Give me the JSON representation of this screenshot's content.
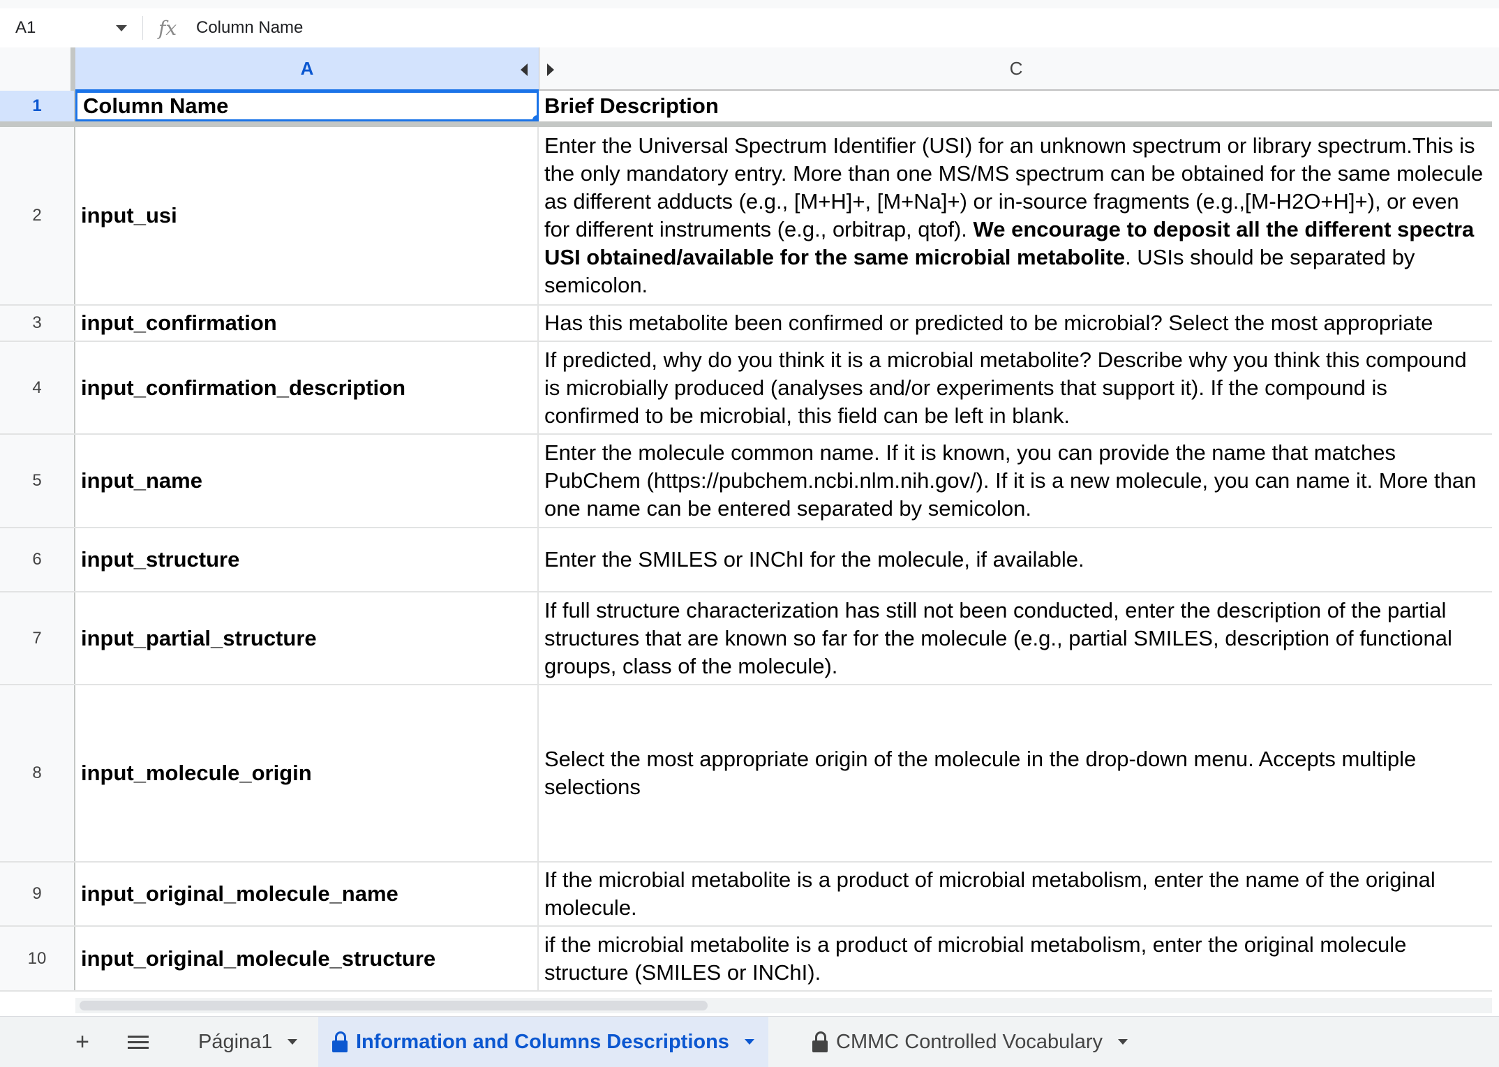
{
  "formula_bar": {
    "cell_ref": "A1",
    "fx_icon": "fx",
    "content": "Column Name"
  },
  "columns": [
    {
      "label": "A"
    },
    {
      "label": "C"
    }
  ],
  "rows": [
    {
      "num": "1",
      "name": "Column Name",
      "desc": "Brief Description"
    },
    {
      "num": "2",
      "name": "input_usi",
      "desc": "Enter the Universal Spectrum Identifier (USI) for an unknown spectrum or library spectrum.This is the only mandatory entry. More than one MS/MS spectrum can be obtained for the same molecule as different adducts (e.g., [M+H]+, [M+Na]+) or in-source fragments (e.g.,[M-H2O+H]+), or even for different instruments (e.g., orbitrap, qtof). ",
      "desc_bold": "We encourage to deposit all the different spectra USI obtained/available for the same microbial metabolite",
      "desc_tail": ". USIs should be separated by semicolon."
    },
    {
      "num": "3",
      "name": "input_confirmation",
      "desc": "Has this metabolite been confirmed or predicted to be microbial? Select the most appropriate"
    },
    {
      "num": "4",
      "name": "input_confirmation_description",
      "desc": "If predicted, why do you think it is a microbial metabolite? Describe why you think this compound is microbially produced (analyses and/or experiments that support it). If the compound is confirmed to be microbial, this field can be left in blank."
    },
    {
      "num": "5",
      "name": "input_name",
      "desc": "Enter the molecule common name. If it is known, you can provide the name that matches PubChem (https://pubchem.ncbi.nlm.nih.gov/). If it is a new molecule, you can name it. More than one name can be entered separated by semicolon."
    },
    {
      "num": "6",
      "name": "input_structure",
      "desc": "Enter the SMILES or INChI for the molecule, if available."
    },
    {
      "num": "7",
      "name": "input_partial_structure",
      "desc": "If full structure characterization has still not been conducted, enter the description of the partial structures that are known so far for the molecule (e.g., partial SMILES, description of functional groups, class of the molecule)."
    },
    {
      "num": "8",
      "name": "input_molecule_origin",
      "desc": "Select the most appropriate origin of the molecule in the drop-down menu. Accepts multiple selections"
    },
    {
      "num": "9",
      "name": "input_original_molecule_name",
      "desc": "If the microbial metabolite is a product of microbial metabolism, enter the name of the original molecule."
    },
    {
      "num": "10",
      "name": "input_original_molecule_structure",
      "desc": "if the microbial metabolite is a product of microbial metabolism, enter the original molecule structure (SMILES or INChI)."
    }
  ],
  "tabs": [
    {
      "label": "Página1",
      "active": false,
      "locked": false
    },
    {
      "label": "Information and Columns Descriptions",
      "active": true,
      "locked": true
    },
    {
      "label": "CMMC Controlled Vocabulary",
      "active": false,
      "locked": true
    }
  ],
  "tab_controls": {
    "add": "+"
  },
  "colors": {
    "accent": "#1a73e8",
    "selected_header_bg": "#d3e3fd",
    "active_tab_bg": "#e1e9f7",
    "active_tab_text": "#0b57d0"
  }
}
